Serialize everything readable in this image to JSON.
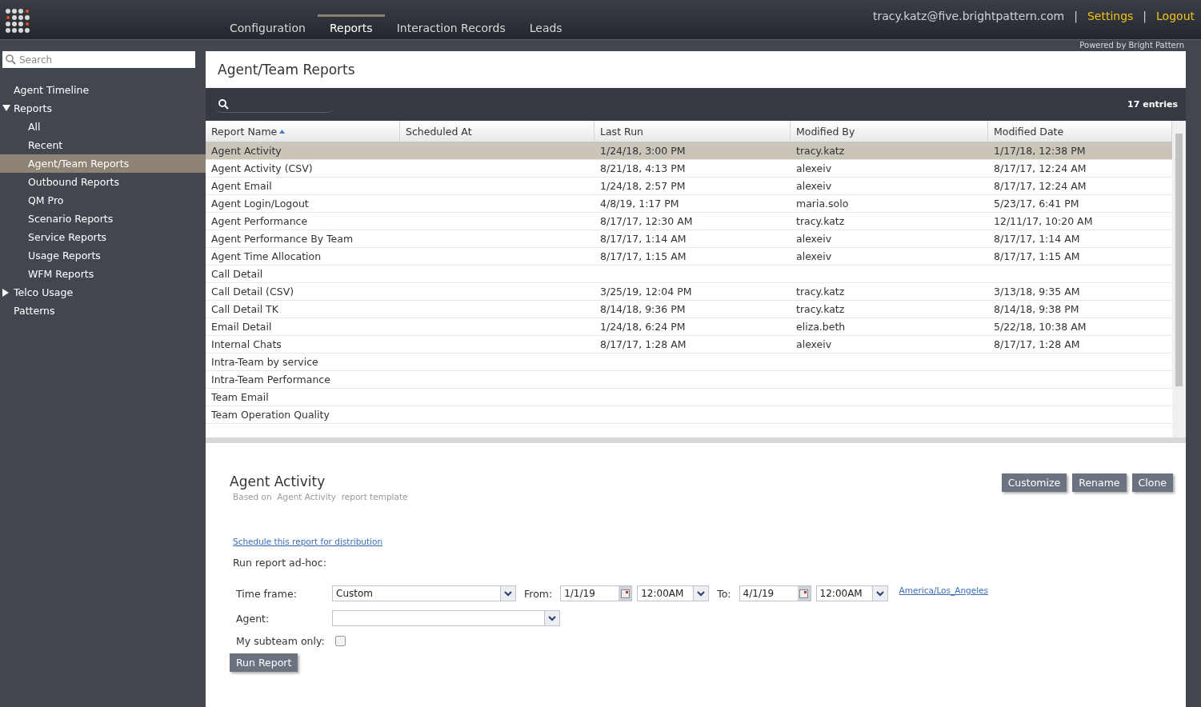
{
  "header": {
    "nav": [
      {
        "label": "Configuration",
        "selected": false
      },
      {
        "label": "Reports",
        "selected": true
      },
      {
        "label": "Interaction Records",
        "selected": false
      },
      {
        "label": "Leads",
        "selected": false
      }
    ],
    "user": "tracy.katz@five.brightpattern.com",
    "separator_1": "|",
    "settings": "Settings",
    "separator_2": "|",
    "logout": "Logout"
  },
  "sidebar": {
    "search": {
      "placeholder": "Search"
    },
    "items": [
      {
        "label": "Agent Timeline",
        "selected": false
      },
      {
        "label": "Reports",
        "selected": false,
        "expanded": true,
        "children": [
          {
            "label": "All",
            "selected": false
          },
          {
            "label": "Recent",
            "selected": false
          },
          {
            "label": "Agent/Team Reports",
            "selected": true
          },
          {
            "label": "Outbound Reports",
            "selected": false
          },
          {
            "label": "QM Pro",
            "selected": false
          },
          {
            "label": "Scenario Reports",
            "selected": false
          },
          {
            "label": "Service Reports",
            "selected": false
          },
          {
            "label": "Usage Reports",
            "selected": false
          },
          {
            "label": "WFM Reports",
            "selected": false
          }
        ]
      },
      {
        "label": "Telco Usage",
        "selected": false,
        "expanded": false
      },
      {
        "label": "Patterns",
        "selected": false
      }
    ]
  },
  "powered_by": "Powered by Bright Pattern",
  "page_title": "Agent/Team Reports",
  "table": {
    "entries": "17 entries",
    "columns": [
      {
        "label": "Report Name",
        "sorted": true
      },
      {
        "label": "Scheduled At",
        "sorted": false
      },
      {
        "label": "Last Run",
        "sorted": false
      },
      {
        "label": "Modified By",
        "sorted": false
      },
      {
        "label": "Modified Date",
        "sorted": false
      }
    ],
    "rows": [
      {
        "selected": true,
        "cells": [
          "Agent Activity",
          "",
          "1/24/18, 3:00 PM",
          "tracy.katz",
          "1/17/18, 12:38 PM"
        ]
      },
      {
        "selected": false,
        "cells": [
          "Agent Activity (CSV)",
          "",
          "8/21/18, 4:13 PM",
          "alexeiv",
          "8/17/17, 12:24 AM"
        ]
      },
      {
        "selected": false,
        "cells": [
          "Agent Email",
          "",
          "1/24/18, 2:57 PM",
          "alexeiv",
          "8/17/17, 12:24 AM"
        ]
      },
      {
        "selected": false,
        "cells": [
          "Agent Login/Logout",
          "",
          "4/8/19, 1:17 PM",
          "maria.solo",
          "5/23/17, 6:41 PM"
        ]
      },
      {
        "selected": false,
        "cells": [
          "Agent Performance",
          "",
          "8/17/17, 12:30 AM",
          "tracy.katz",
          "12/11/17, 10:20 AM"
        ]
      },
      {
        "selected": false,
        "cells": [
          "Agent Performance By Team",
          "",
          "8/17/17, 1:14 AM",
          "alexeiv",
          "8/17/17, 1:14 AM"
        ]
      },
      {
        "selected": false,
        "cells": [
          "Agent Time Allocation",
          "",
          "8/17/17, 1:15 AM",
          "alexeiv",
          "8/17/17, 1:15 AM"
        ]
      },
      {
        "selected": false,
        "cells": [
          "Call Detail",
          "",
          "",
          "",
          ""
        ]
      },
      {
        "selected": false,
        "cells": [
          "Call Detail (CSV)",
          "",
          "3/25/19, 12:04 PM",
          "tracy.katz",
          "3/13/18, 9:35 AM"
        ]
      },
      {
        "selected": false,
        "cells": [
          "Call Detail TK",
          "",
          "8/14/18, 9:36 PM",
          "tracy.katz",
          "8/14/18, 9:38 PM"
        ]
      },
      {
        "selected": false,
        "cells": [
          "Email Detail",
          "",
          "1/24/18, 6:24 PM",
          "eliza.beth",
          "5/22/18, 10:38 AM"
        ]
      },
      {
        "selected": false,
        "cells": [
          "Internal Chats",
          "",
          "8/17/17, 1:28 AM",
          "alexeiv",
          "8/17/17, 1:28 AM"
        ]
      },
      {
        "selected": false,
        "cells": [
          "Intra-Team by service",
          "",
          "",
          "",
          ""
        ]
      },
      {
        "selected": false,
        "cells": [
          "Intra-Team Performance",
          "",
          "",
          "",
          ""
        ]
      },
      {
        "selected": false,
        "cells": [
          "Team Email",
          "",
          "",
          "",
          ""
        ]
      },
      {
        "selected": false,
        "cells": [
          "Team Operation Quality",
          "",
          "",
          "",
          ""
        ]
      }
    ]
  },
  "details": {
    "title": "Agent Activity",
    "subtitle": "Based on  Agent Activity  report template",
    "buttons": [
      "Customize",
      "Rename",
      "Clone"
    ],
    "schedule_link": "Schedule this report for distribution",
    "run_label": "Run report ad-hoc:",
    "time_frame": {
      "label": "Time frame:",
      "value": "Custom"
    },
    "from": {
      "label": "From:",
      "date": "1/1/19",
      "time": "12:00AM"
    },
    "to": {
      "label": "To:",
      "date": "4/1/19",
      "time": "12:00AM"
    },
    "timezone": "America/Los_Angeles",
    "agent": {
      "label": "Agent:"
    },
    "subteam": {
      "label": "My subteam only:",
      "checked": false
    },
    "run_button": "Run Report"
  }
}
